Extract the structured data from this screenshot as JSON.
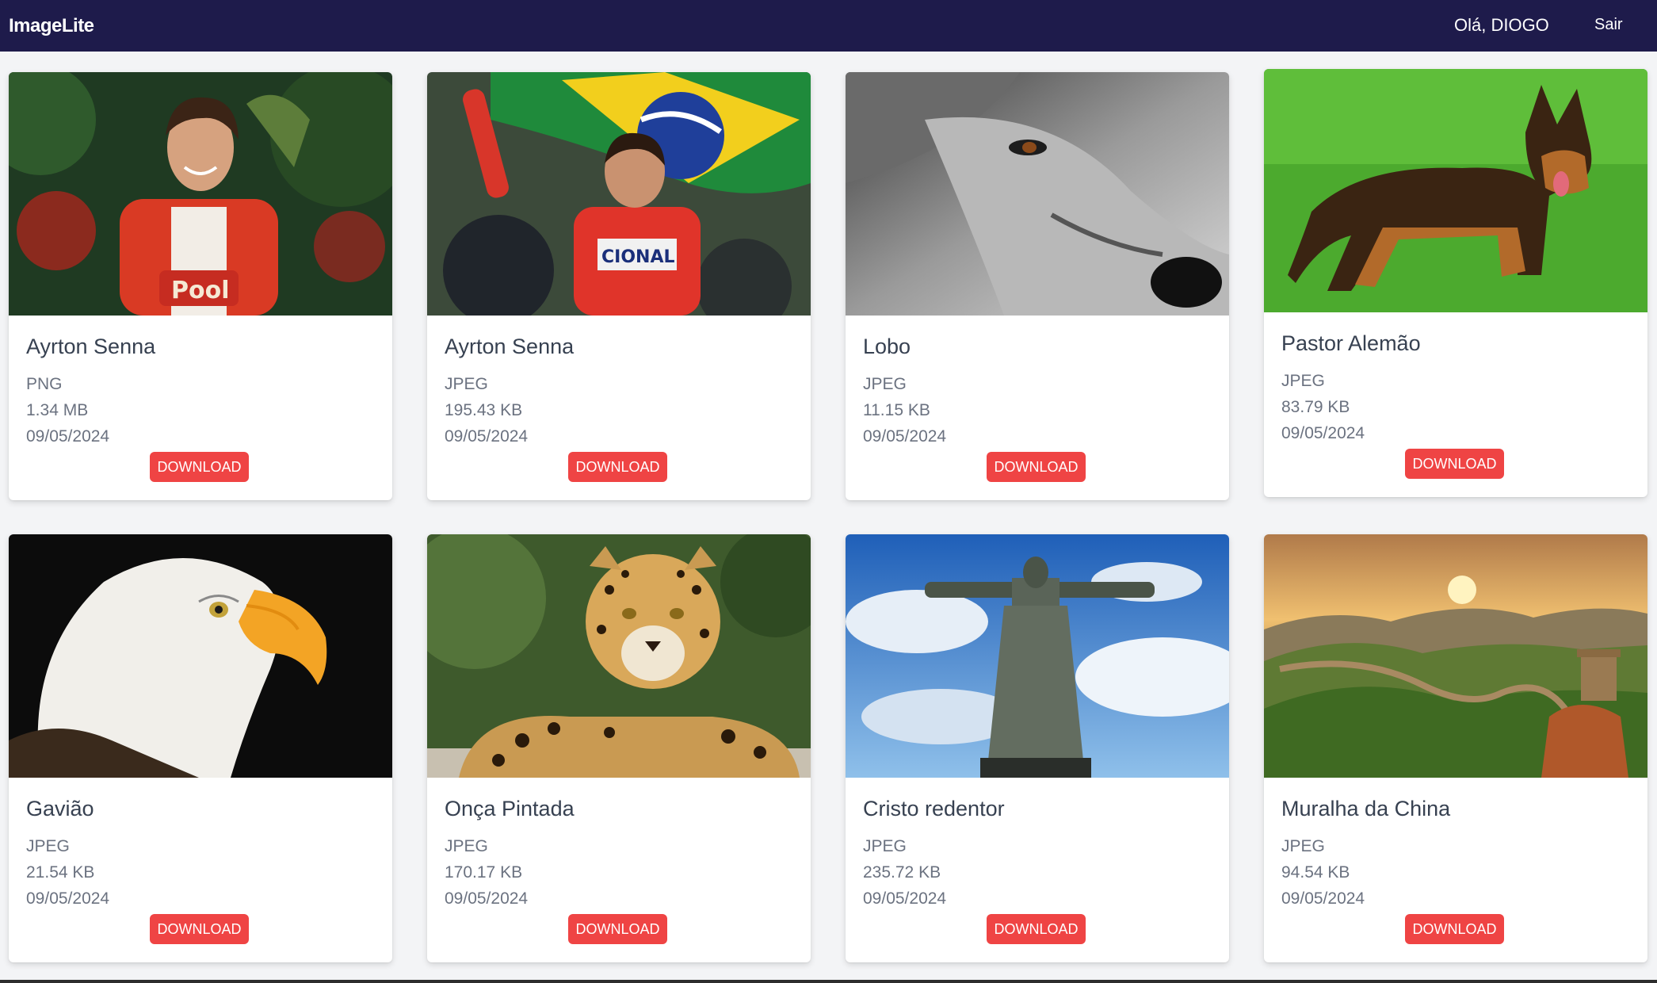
{
  "navbar": {
    "brand": "ImageLite",
    "greeting": "Olá, DIOGO",
    "logout_label": "Sair"
  },
  "download_label": "DOWNLOAD",
  "cards": [
    {
      "name": "Ayrton Senna",
      "extension": "PNG",
      "size": "1.34 MB",
      "date": "09/05/2024",
      "image": "ayrton-senna-portrait-photo"
    },
    {
      "name": "Ayrton Senna",
      "extension": "JPEG",
      "size": "195.43 KB",
      "date": "09/05/2024",
      "image": "ayrton-senna-flag-photo"
    },
    {
      "name": "Lobo",
      "extension": "JPEG",
      "size": "11.15 KB",
      "date": "09/05/2024",
      "image": "wolf-photo"
    },
    {
      "name": "Pastor Alemão",
      "extension": "JPEG",
      "size": "83.79 KB",
      "date": "09/05/2024",
      "image": "german-shepherd-photo"
    },
    {
      "name": "Gavião",
      "extension": "JPEG",
      "size": "21.54 KB",
      "date": "09/05/2024",
      "image": "eagle-photo"
    },
    {
      "name": "Onça Pintada",
      "extension": "JPEG",
      "size": "170.17 KB",
      "date": "09/05/2024",
      "image": "jaguar-photo"
    },
    {
      "name": "Cristo redentor",
      "extension": "JPEG",
      "size": "235.72 KB",
      "date": "09/05/2024",
      "image": "christ-redeemer-photo"
    },
    {
      "name": "Muralha da China",
      "extension": "JPEG",
      "size": "94.54 KB",
      "date": "09/05/2024",
      "image": "great-wall-photo"
    }
  ],
  "colors": {
    "navbar": "#1e1b4b",
    "download_button": "#ef4444"
  }
}
